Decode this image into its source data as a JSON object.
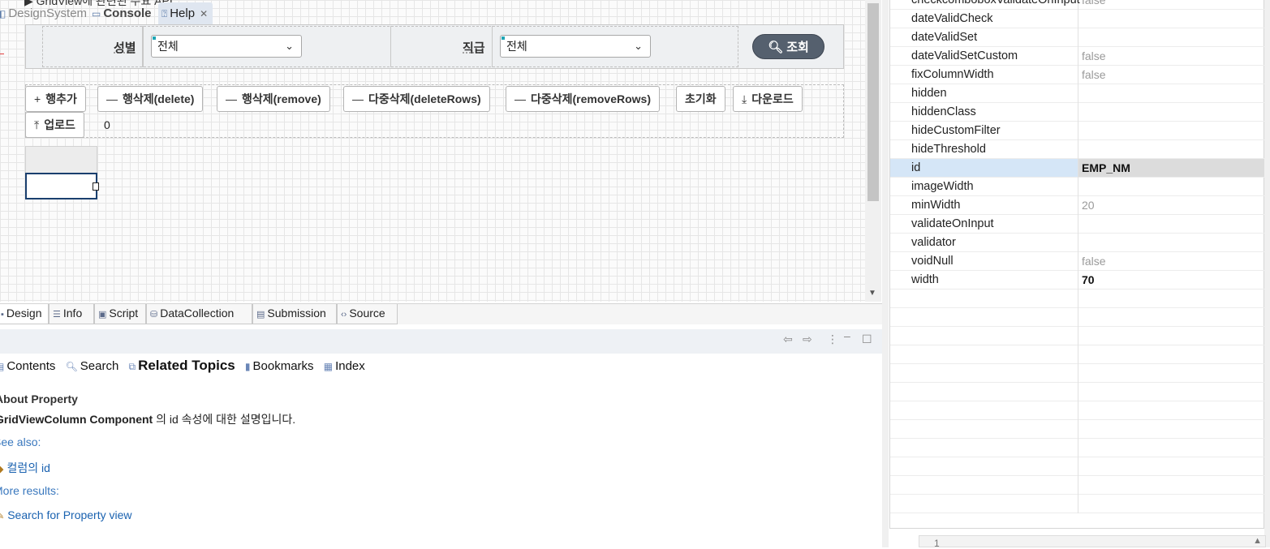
{
  "design": {
    "cut_title": "▶ GridView에 관련된 주요 API",
    "search": {
      "label_gender": "성별",
      "select_gender": "전체",
      "label_rank": "직급",
      "select_rank": "전체",
      "button": "조회"
    },
    "buttons": {
      "add_row": "행추가",
      "delete_row": "행삭제(delete)",
      "remove_row": "행삭제(remove)",
      "delete_rows": "다중삭제(deleteRows)",
      "remove_rows": "다중삭제(removeRows)",
      "reset": "초기화",
      "download": "다운로드",
      "upload": "업로드"
    },
    "row_count": "0"
  },
  "editor_tabs": [
    "Design",
    "Info",
    "Script",
    "DataCollection",
    "Submission",
    "Source"
  ],
  "view_tabs": {
    "designsystem": "DesignSystem",
    "console": "Console",
    "help": "Help"
  },
  "help": {
    "nav": {
      "contents": "Contents",
      "search": "Search",
      "related": "Related Topics",
      "bookmarks": "Bookmarks",
      "index": "Index"
    },
    "heading": "About Property",
    "component": "GridViewColumn Component",
    "desc": " 의 id 속성에 대한 설명입니다.",
    "see_also": "See also:",
    "link_column_id": "컬럼의 id",
    "more_results": "More results:",
    "link_search_property": "Search for Property view"
  },
  "properties": [
    {
      "name": "checkcomboboxValidateOnInput",
      "value": "false"
    },
    {
      "name": "dateValidCheck",
      "value": ""
    },
    {
      "name": "dateValidSet",
      "value": ""
    },
    {
      "name": "dateValidSetCustom",
      "value": "false"
    },
    {
      "name": "fixColumnWidth",
      "value": "false"
    },
    {
      "name": "hidden",
      "value": ""
    },
    {
      "name": "hiddenClass",
      "value": ""
    },
    {
      "name": "hideCustomFilter",
      "value": ""
    },
    {
      "name": "hideThreshold",
      "value": ""
    },
    {
      "name": "id",
      "value": "EMP_NM"
    },
    {
      "name": "imageWidth",
      "value": ""
    },
    {
      "name": "minWidth",
      "value": "20"
    },
    {
      "name": "validateOnInput",
      "value": ""
    },
    {
      "name": "validator",
      "value": ""
    },
    {
      "name": "voidNull",
      "value": "false"
    },
    {
      "name": "width",
      "value": "70"
    }
  ],
  "mini_editor_line": "1"
}
